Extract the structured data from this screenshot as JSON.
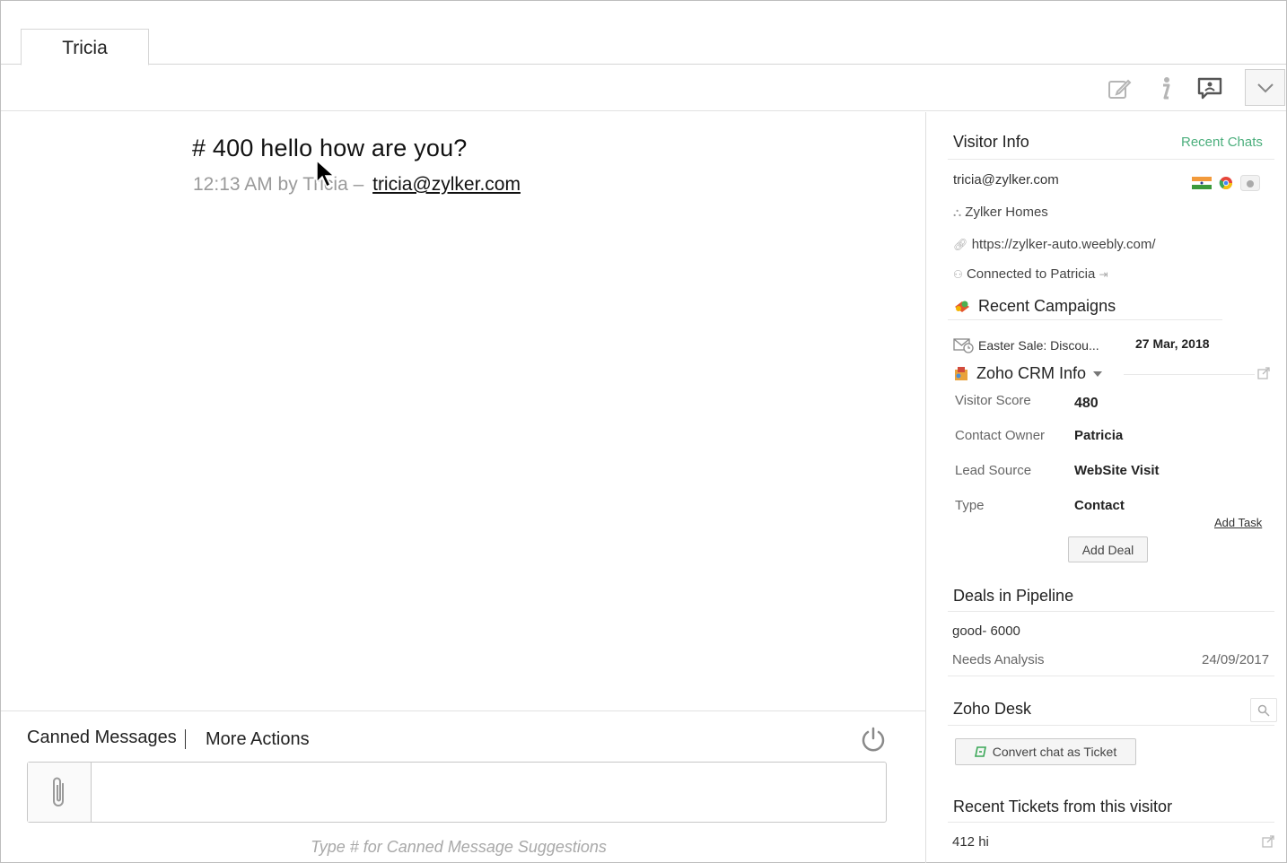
{
  "tab": {
    "label": "Tricia"
  },
  "message": {
    "text": "# 400  hello how are you?",
    "meta_prefix": "12:13 AM by Tricia – ",
    "email": "tricia@zylker.com"
  },
  "composer": {
    "canned_label": "Canned Messages",
    "more_label": "More Actions",
    "placeholder": "",
    "hint": "Type # for Canned Message Suggestions"
  },
  "visitor": {
    "title": "Visitor Info",
    "recent_chats": "Recent Chats",
    "email": "tricia@zylker.com",
    "company": "Zylker Homes",
    "url": "https://zylker-auto.weebly.com/",
    "connected": "Connected to Patricia"
  },
  "campaigns": {
    "title": "Recent Campaigns",
    "item_name": "Easter Sale: Discou...",
    "item_date": "27 Mar, 2018"
  },
  "crm": {
    "title": "Zoho CRM Info",
    "rows": [
      {
        "label": "Visitor Score",
        "value": "480"
      },
      {
        "label": "Contact Owner",
        "value": "Patricia"
      },
      {
        "label": "Lead Source",
        "value": "WebSite Visit"
      },
      {
        "label": "Type",
        "value": "Contact"
      }
    ],
    "add_task": "Add Task",
    "add_deal": "Add Deal"
  },
  "deals": {
    "title": "Deals in Pipeline",
    "name": "good- 6000",
    "stage": "Needs Analysis",
    "date": "24/09/2017"
  },
  "desk": {
    "title": "Zoho Desk",
    "convert": "Convert chat as Ticket"
  },
  "tickets": {
    "title": "Recent Tickets from this visitor",
    "item": "412 hi"
  },
  "colors": {
    "accent": "#4caf7d",
    "border": "#d6d6d6"
  },
  "icons": [
    "edit-icon",
    "info-icon",
    "chat-bubble-icon",
    "chevron-down-icon",
    "power-icon",
    "paperclip-icon",
    "search-icon",
    "external-link-icon"
  ]
}
